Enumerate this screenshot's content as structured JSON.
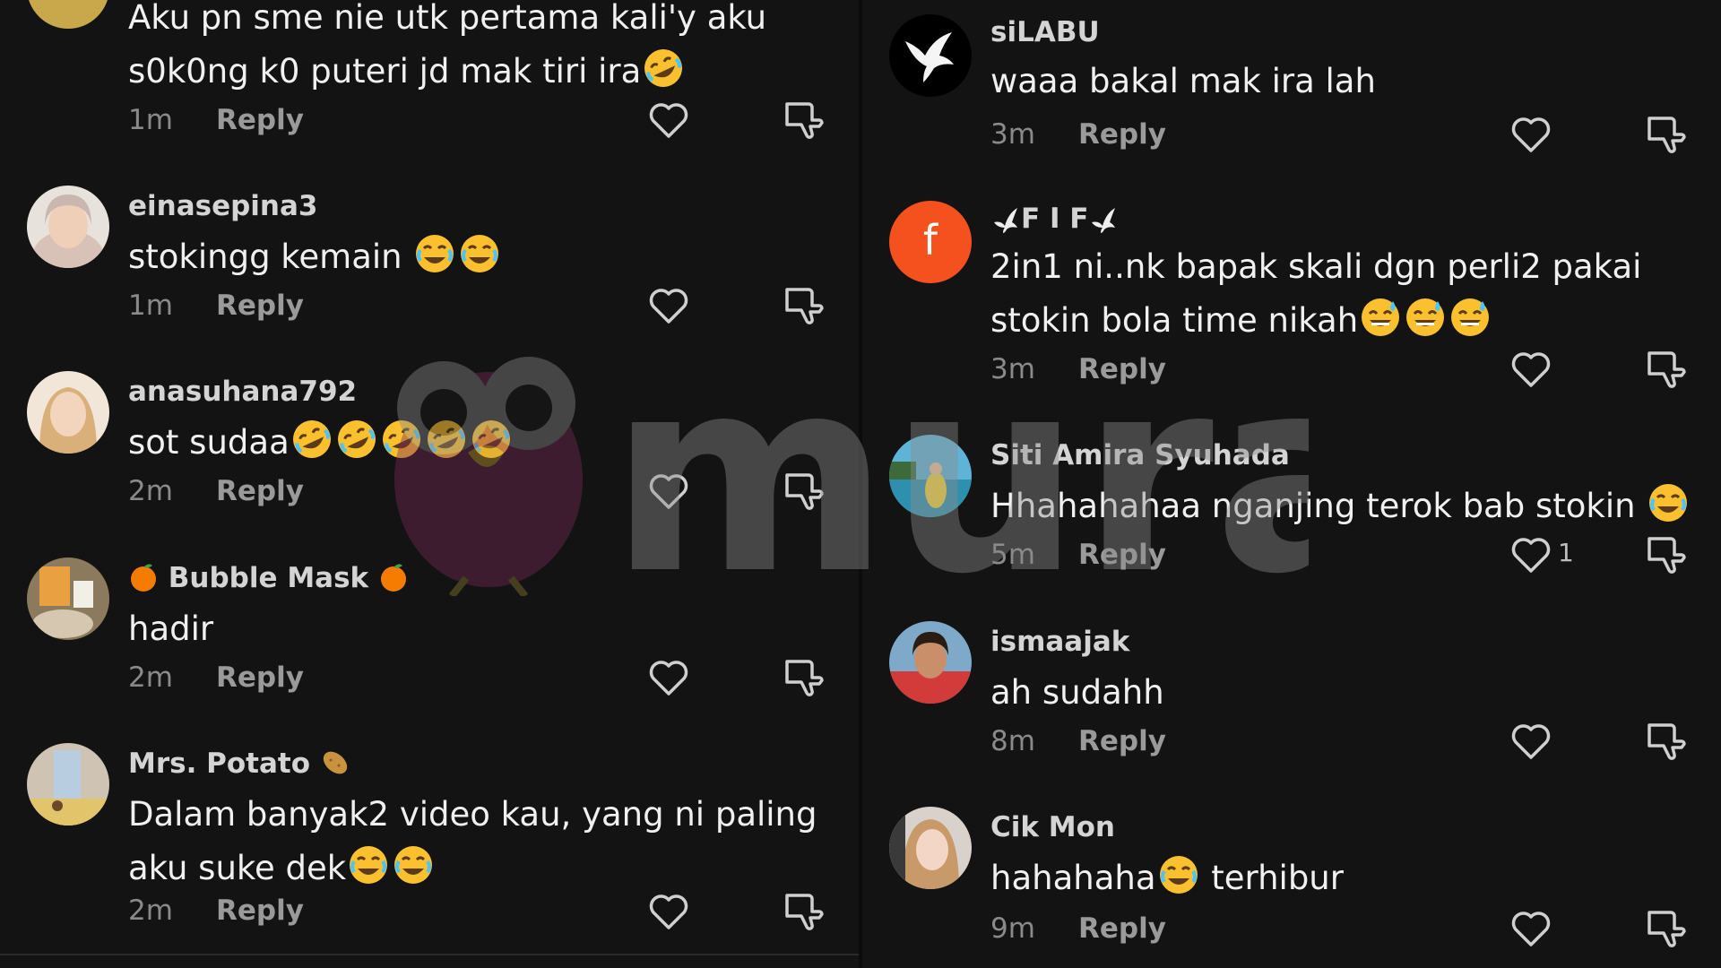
{
  "left": [
    {
      "username": "",
      "text_lines": [
        "Aku pn sme nie utk pertama kali'y aku",
        "s0k0ng k0 puteri jd mak tiri ira"
      ],
      "emojis": [
        "rofl-emoji"
      ],
      "time": "1m",
      "reply": "Reply"
    },
    {
      "username": "einasepina3",
      "text": "stokingg kemain",
      "emojis": [
        "joy-emoji",
        "joy-emoji"
      ],
      "time": "1m",
      "reply": "Reply"
    },
    {
      "username": "anasuhana792",
      "text": "sot sudaa",
      "emojis": [
        "rofl-emoji",
        "rofl-emoji",
        "rofl-emoji",
        "rofl-emoji",
        "rofl-emoji"
      ],
      "time": "2m",
      "reply": "Reply"
    },
    {
      "username": "Bubble Mask",
      "name_emoji": "tangerine-emoji",
      "text": "hadir",
      "time": "2m",
      "reply": "Reply"
    },
    {
      "username": "Mrs. Potato",
      "name_emoji": "potato-emoji",
      "text_lines": [
        "Dalam banyak2 video kau, yang ni paling",
        "aku suke dek"
      ],
      "emojis": [
        "joy-emoji",
        "joy-emoji"
      ],
      "time": "2m",
      "reply": "Reply"
    }
  ],
  "right": [
    {
      "username": "siLABU",
      "text": "waaa bakal mak ira lah",
      "time": "3m",
      "reply": "Reply"
    },
    {
      "username": "F I F",
      "avatar_letter": "f",
      "text_lines": [
        "2in1 ni..nk bapak skali dgn perli2 pakai",
        "stokin bola time nikah"
      ],
      "emojis": [
        "sweat-smile-emoji",
        "sweat-smile-emoji",
        "sweat-smile-emoji"
      ],
      "time": "3m",
      "reply": "Reply"
    },
    {
      "username": "Siti Amira Syuhada",
      "text": "Hhahahahaa nganjing terok bab stokin",
      "emojis": [
        "joy-emoji"
      ],
      "time": "5m",
      "reply": "Reply",
      "likes": "1"
    },
    {
      "username": "ismaajak",
      "text": "ah sudahh",
      "time": "8m",
      "reply": "Reply"
    },
    {
      "username": "Cik Mon",
      "text_before": "hahahaha",
      "text_after": " terhibur",
      "emojis": [
        "joy-emoji"
      ],
      "time": "9m",
      "reply": "Reply"
    }
  ],
  "watermark": {
    "text": "murai"
  },
  "colors": {
    "background": "#131313",
    "avatar_f": "#f4511e",
    "emoji_yellow": "#fbc02d"
  }
}
